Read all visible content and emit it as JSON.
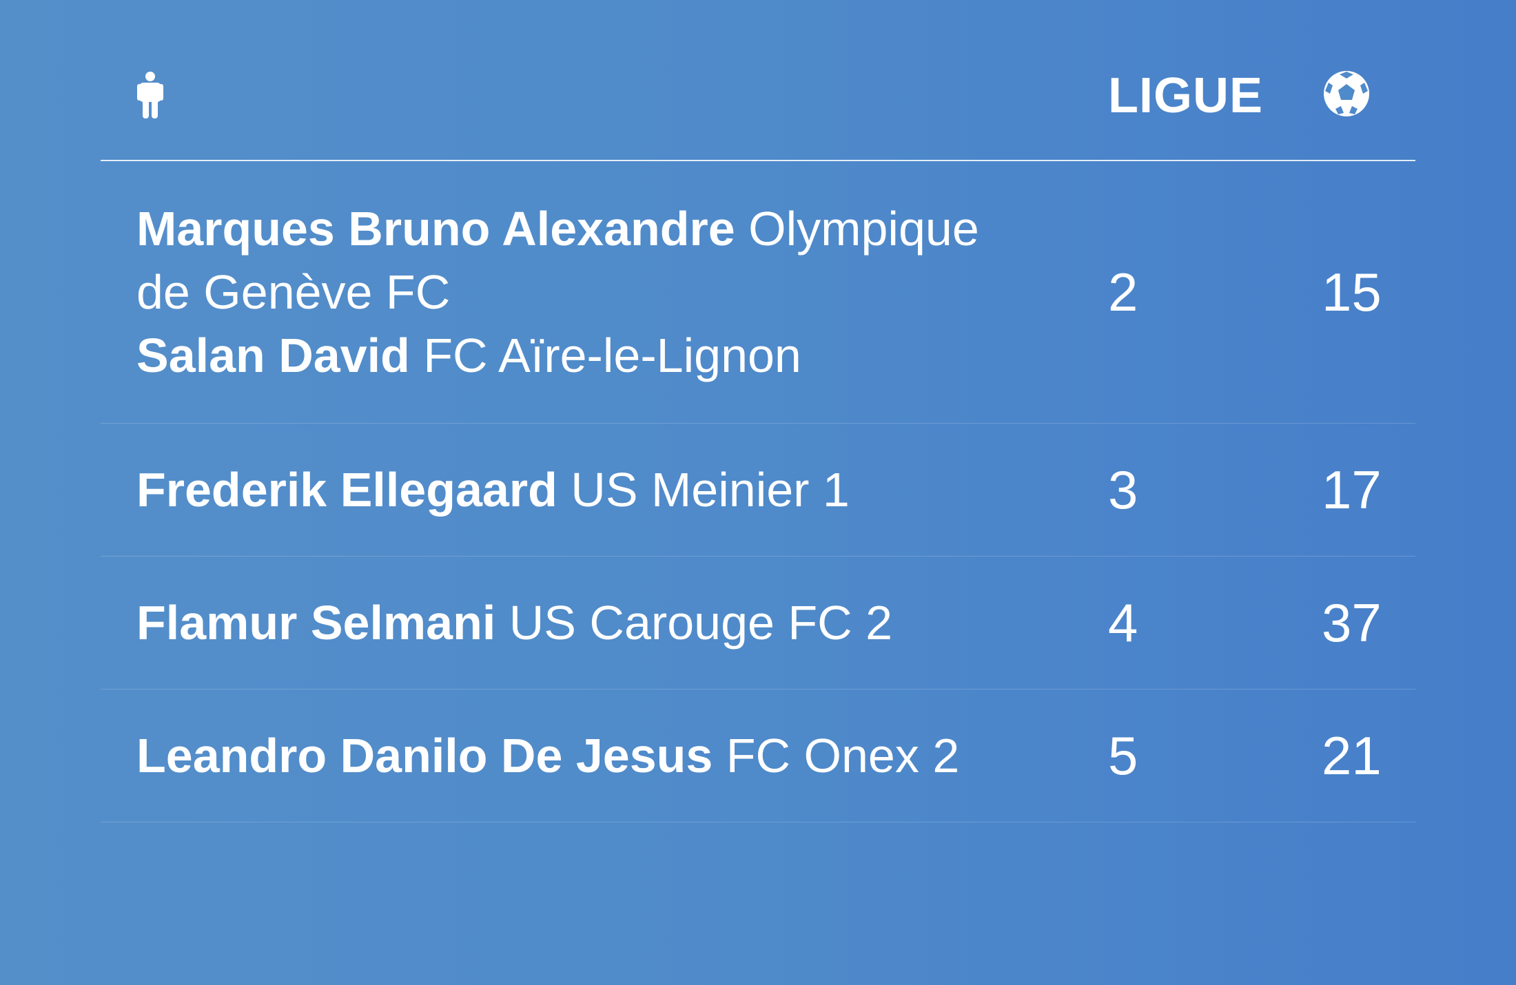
{
  "header": {
    "player_icon": "person-icon",
    "league_label": "LIGUE",
    "goals_icon": "soccer-ball-icon"
  },
  "rows": [
    {
      "players": [
        {
          "name": "Marques Bruno Alexandre",
          "club": "Olympique de Genève FC"
        },
        {
          "name": "Salan David",
          "club": "FC Aïre-le-Lignon"
        }
      ],
      "league": "2",
      "goals": "15"
    },
    {
      "players": [
        {
          "name": "Frederik Ellegaard",
          "club": "US Meinier 1"
        }
      ],
      "league": "3",
      "goals": "17"
    },
    {
      "players": [
        {
          "name": "Flamur Selmani",
          "club": "US Carouge FC 2"
        }
      ],
      "league": "4",
      "goals": "37"
    },
    {
      "players": [
        {
          "name": "Leandro Danilo De Jesus",
          "club": "FC Onex 2"
        }
      ],
      "league": "5",
      "goals": "21"
    }
  ],
  "colors": {
    "background_left": "#558fca",
    "background_right": "#467ec9",
    "text": "#ffffff"
  }
}
